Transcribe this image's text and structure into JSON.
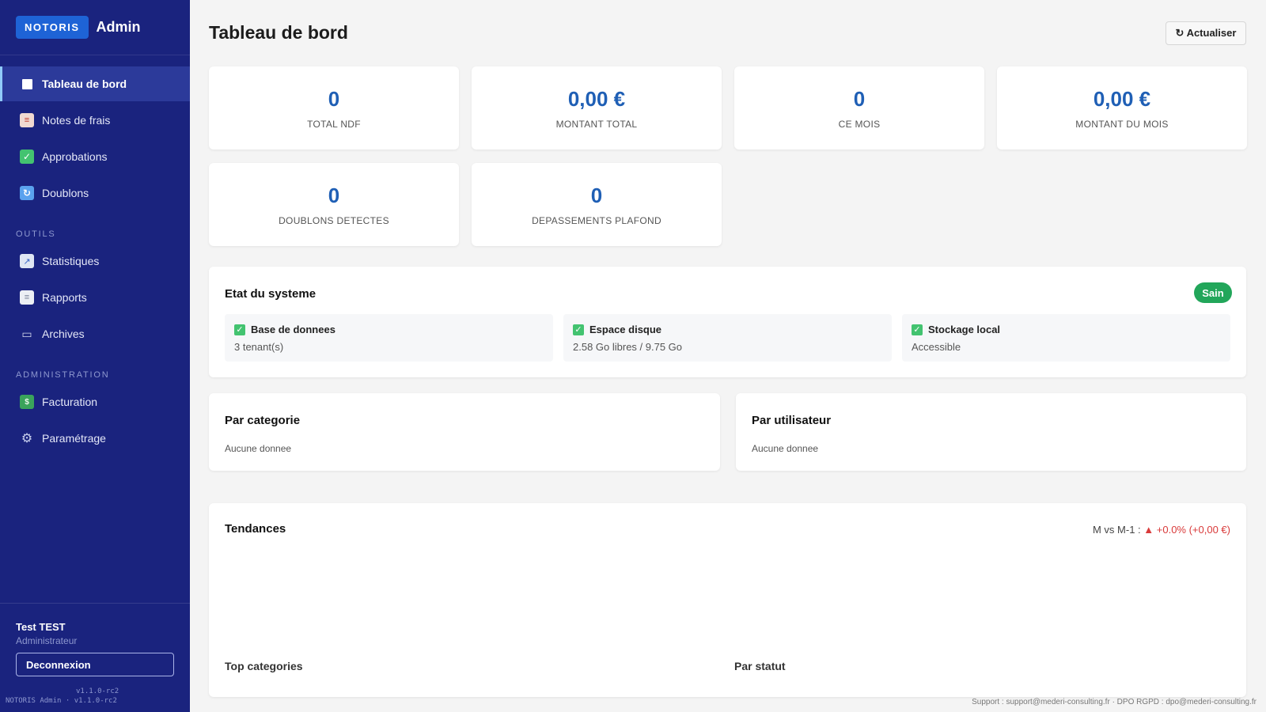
{
  "brand": {
    "badge": "NOTORIS",
    "app": "Admin"
  },
  "nav": {
    "main": [
      {
        "label": "Tableau de bord",
        "icon": "dashboard-icon"
      },
      {
        "label": "Notes de frais",
        "icon": "receipt-icon"
      },
      {
        "label": "Approbations",
        "icon": "check-icon"
      },
      {
        "label": "Doublons",
        "icon": "sync-icon"
      }
    ],
    "section_tools": "OUTILS",
    "tools": [
      {
        "label": "Statistiques",
        "icon": "chart-icon"
      },
      {
        "label": "Rapports",
        "icon": "document-icon"
      },
      {
        "label": "Archives",
        "icon": "archive-icon"
      }
    ],
    "section_admin": "ADMINISTRATION",
    "admin": [
      {
        "label": "Facturation",
        "icon": "money-icon"
      },
      {
        "label": "Paramétrage",
        "icon": "gear-icon"
      }
    ]
  },
  "user": {
    "name": "Test TEST",
    "role": "Administrateur",
    "logout": "Deconnexion"
  },
  "version": {
    "short": "v1.1.0-rc2",
    "full": "NOTORIS Admin · v1.1.0-rc2"
  },
  "page": {
    "title": "Tableau de bord",
    "refresh": "↻ Actualiser"
  },
  "stats": [
    {
      "value": "0",
      "label": "TOTAL NDF"
    },
    {
      "value": "0,00 €",
      "label": "MONTANT TOTAL"
    },
    {
      "value": "0",
      "label": "CE MOIS"
    },
    {
      "value": "0,00 €",
      "label": "MONTANT DU MOIS"
    },
    {
      "value": "0",
      "label": "DOUBLONS DETECTES"
    },
    {
      "value": "0",
      "label": "DEPASSEMENTS PLAFOND"
    }
  ],
  "system": {
    "title": "Etat du systeme",
    "status": "Sain",
    "items": [
      {
        "title": "Base de donnees",
        "detail": "3 tenant(s)"
      },
      {
        "title": "Espace disque",
        "detail": "2.58 Go libres / 9.75 Go"
      },
      {
        "title": "Stockage local",
        "detail": "Accessible"
      }
    ]
  },
  "by_category": {
    "title": "Par categorie",
    "empty": "Aucune donnee"
  },
  "by_user": {
    "title": "Par utilisateur",
    "empty": "Aucune donnee"
  },
  "trends": {
    "title": "Tendances",
    "compare_label": "M vs M-1 :",
    "compare_value": "▲ +0.0% (+0,00 €)",
    "top_categories": "Top categories",
    "by_status": "Par statut"
  },
  "footer": "Support : support@mederi-consulting.fr  ·  DPO RGPD : dpo@mederi-consulting.fr"
}
